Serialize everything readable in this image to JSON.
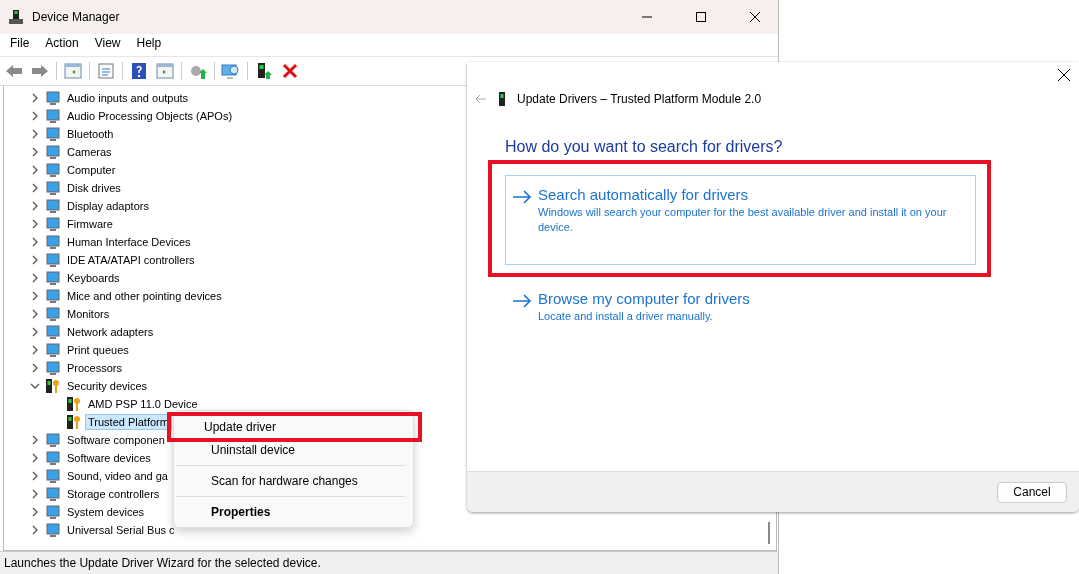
{
  "window": {
    "title": "Device Manager"
  },
  "menu_bar": [
    {
      "label": "File"
    },
    {
      "label": "Action"
    },
    {
      "label": "View"
    },
    {
      "label": "Help"
    }
  ],
  "tree": [
    {
      "label": "Audio inputs and outputs",
      "expanded": false
    },
    {
      "label": "Audio Processing Objects (APOs)",
      "expanded": false
    },
    {
      "label": "Bluetooth",
      "expanded": false
    },
    {
      "label": "Cameras",
      "expanded": false
    },
    {
      "label": "Computer",
      "expanded": false
    },
    {
      "label": "Disk drives",
      "expanded": false
    },
    {
      "label": "Display adaptors",
      "expanded": false
    },
    {
      "label": "Firmware",
      "expanded": false
    },
    {
      "label": "Human Interface Devices",
      "expanded": false
    },
    {
      "label": "IDE ATA/ATAPI controllers",
      "expanded": false
    },
    {
      "label": "Keyboards",
      "expanded": false
    },
    {
      "label": "Mice and other pointing devices",
      "expanded": false
    },
    {
      "label": "Monitors",
      "expanded": false
    },
    {
      "label": "Network adapters",
      "expanded": false
    },
    {
      "label": "Print queues",
      "expanded": false
    },
    {
      "label": "Processors",
      "expanded": false
    },
    {
      "label": "Security devices",
      "expanded": true,
      "children": [
        {
          "label": "AMD PSP 11.0 Device",
          "selected": false
        },
        {
          "label": "Trusted Platform",
          "selected": true
        }
      ]
    },
    {
      "label": "Software componen",
      "expanded": false
    },
    {
      "label": "Software devices",
      "expanded": false
    },
    {
      "label": "Sound, video and ga",
      "expanded": false
    },
    {
      "label": "Storage controllers",
      "expanded": false
    },
    {
      "label": "System devices",
      "expanded": false
    },
    {
      "label": "Universal Serial Bus c",
      "expanded": false
    }
  ],
  "status_bar": "Launches the Update Driver Wizard for the selected device.",
  "context_menu": [
    {
      "kind": "item",
      "label": "Update driver",
      "default": false,
      "highlighted": true
    },
    {
      "kind": "item",
      "label": "Uninstall device",
      "default": false,
      "highlighted": false
    },
    {
      "kind": "separator"
    },
    {
      "kind": "item",
      "label": "Scan for hardware changes",
      "default": false,
      "highlighted": false
    },
    {
      "kind": "separator"
    },
    {
      "kind": "item",
      "label": "Properties",
      "default": true,
      "highlighted": false
    }
  ],
  "dialog": {
    "title": "Update Drivers – Trusted Platform Module 2.0",
    "back_disabled": true,
    "heading": "How do you want to search for drivers?",
    "options": [
      {
        "title": "Search automatically for drivers",
        "description": "Windows will search your computer for the best available driver and install it on your device.",
        "focused": true,
        "highlighted": true
      },
      {
        "title": "Browse my computer for drivers",
        "description": "Locate and install a driver manually.",
        "focused": false,
        "highlighted": false
      }
    ],
    "buttons": [
      "Cancel"
    ]
  }
}
